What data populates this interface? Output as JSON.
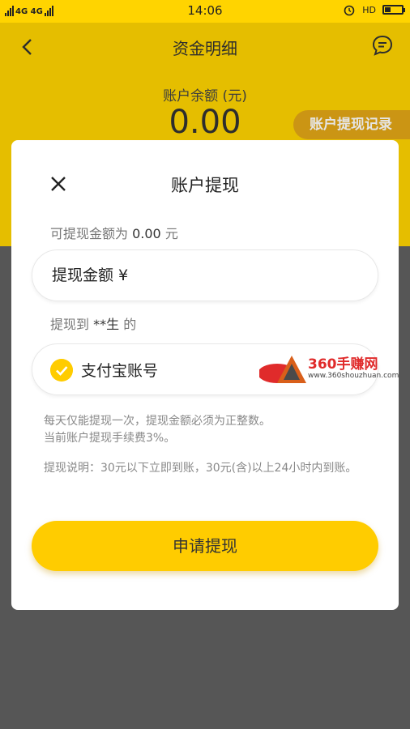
{
  "status_bar": {
    "left_text": "4G 4G",
    "time": "14:06",
    "right_text": "HD"
  },
  "header": {
    "title": "资金明细",
    "balance_label": "账户余额 (元)",
    "balance_value": "0.00",
    "record_button": "账户提现记录"
  },
  "dialog": {
    "title": "账户提现",
    "available_prefix": "可提现金额为",
    "available_amount": "0.00",
    "available_unit": "元",
    "amount_placeholder": "提现金额 ¥",
    "to_prefix": "提现到",
    "to_name": "**生",
    "to_suffix": "的",
    "account_label": "支付宝账号",
    "notice_line1": "每天仅能提现一次，提现金额必须为正整数。",
    "notice_line2": "当前账户提现手续费3%。",
    "notice_detail": "提现说明：30元以下立即到账，30元(含)以上24小时内到账。",
    "submit_label": "申请提现"
  },
  "watermark": {
    "brand": "360手赚网",
    "url": "www.360shouzhuan.com"
  },
  "colors": {
    "brand_yellow": "#ffd400",
    "button_yellow": "#ffcc00",
    "record_orange": "#e2a617",
    "overlay": "#565656"
  }
}
